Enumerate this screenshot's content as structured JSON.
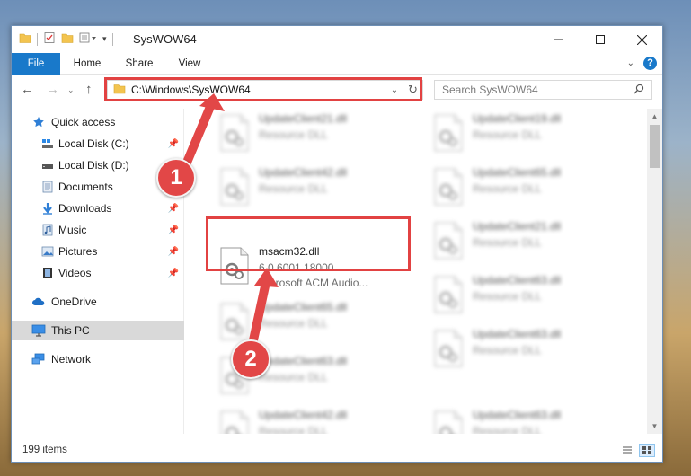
{
  "window": {
    "title": "SysWOW64"
  },
  "ribbon": {
    "tabs": [
      "File",
      "Home",
      "Share",
      "View"
    ]
  },
  "navigation": {
    "address_path": "C:\\Windows\\SysWOW64",
    "search_placeholder": "Search SysWOW64"
  },
  "sidebar": {
    "items": [
      {
        "label": "Quick access",
        "icon": "star-icon"
      },
      {
        "label": "Local Disk (C:)",
        "icon": "drive-icon",
        "pinned": true
      },
      {
        "label": "Local Disk (D:)",
        "icon": "drive-icon",
        "pinned": true
      },
      {
        "label": "Documents",
        "icon": "documents-icon",
        "pinned": true
      },
      {
        "label": "Downloads",
        "icon": "download-icon",
        "pinned": true
      },
      {
        "label": "Music",
        "icon": "music-icon",
        "pinned": true
      },
      {
        "label": "Pictures",
        "icon": "pictures-icon",
        "pinned": true
      },
      {
        "label": "Videos",
        "icon": "videos-icon",
        "pinned": true
      },
      {
        "label": "OneDrive",
        "icon": "cloud-icon"
      },
      {
        "label": "This PC",
        "icon": "computer-icon",
        "selected": true
      },
      {
        "label": "Network",
        "icon": "network-icon"
      }
    ]
  },
  "files": {
    "left_column": [
      {
        "name": "UpdateClient21.dll",
        "type": "Resource DLL"
      },
      {
        "name": "UpdateClient42.dll",
        "type": "Resource DLL"
      },
      {
        "name": "msacm32.dll",
        "version": "6.0.6001.18000",
        "description": "Microsoft ACM Audio...",
        "highlighted": true
      },
      {
        "name": "UpdateClient65.dll",
        "type": "Resource DLL"
      },
      {
        "name": "UpdateClient63.dll",
        "type": "Resource DLL"
      },
      {
        "name": "UpdateClient42.dll",
        "type": "Resource DLL"
      }
    ],
    "right_column": [
      {
        "name": "UpdateClient19.dll",
        "type": "Resource DLL"
      },
      {
        "name": "UpdateClient65.dll",
        "type": "Resource DLL"
      },
      {
        "name": "UpdateClient21.dll",
        "type": "Resource DLL"
      },
      {
        "name": "UpdateClient63.dll",
        "type": "Resource DLL"
      },
      {
        "name": "UpdateClient63.dll",
        "type": "Resource DLL"
      },
      {
        "name": "UpdateClient63.dll",
        "type": "Resource DLL"
      }
    ]
  },
  "status": {
    "item_count": "199 items"
  },
  "annotations": {
    "callout_1": "1",
    "callout_2": "2"
  },
  "colors": {
    "accent": "#1979ca",
    "highlight": "#e24242"
  }
}
